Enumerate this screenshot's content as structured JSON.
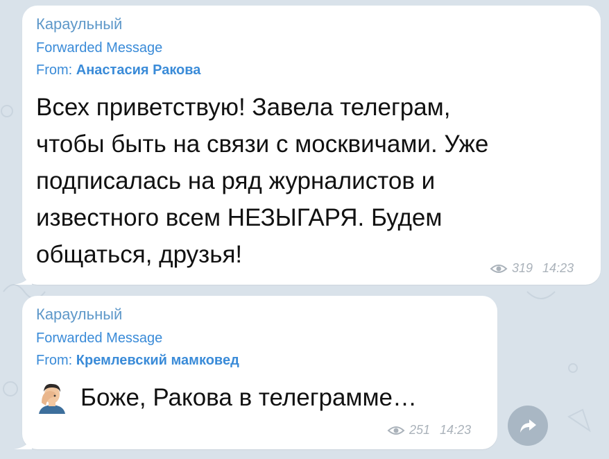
{
  "messages": [
    {
      "channel": "Караульный",
      "forwarded_label": "Forwarded Message",
      "from_prefix": "From: ",
      "from_author": "Анастасия Ракова",
      "text_lines": [
        "Всех приветствую! Завела телеграм,",
        "чтобы быть на связи с москвичами. Уже",
        "подписалась на ряд журналистов и",
        "известного всем НЕЗЫГАРЯ. Будем",
        "общаться, друзья!"
      ],
      "views": "319",
      "time": "14:23"
    },
    {
      "channel": "Караульный",
      "forwarded_label": "Forwarded Message",
      "from_prefix": "From: ",
      "from_author": "Кремлевский мамковед",
      "emoji_icon": "facepalm-emoji",
      "text": "Боже, Ракова в телеграмме…",
      "views": "251",
      "time": "14:23"
    }
  ],
  "icons": {
    "views": "eye-icon",
    "share": "share-arrow-icon"
  },
  "colors": {
    "background": "#d9e2ea",
    "channel_name": "#5e98c9",
    "link_blue": "#3a8bd8",
    "meta_gray": "#aab2ba",
    "share_button": "#a9b7c4"
  }
}
